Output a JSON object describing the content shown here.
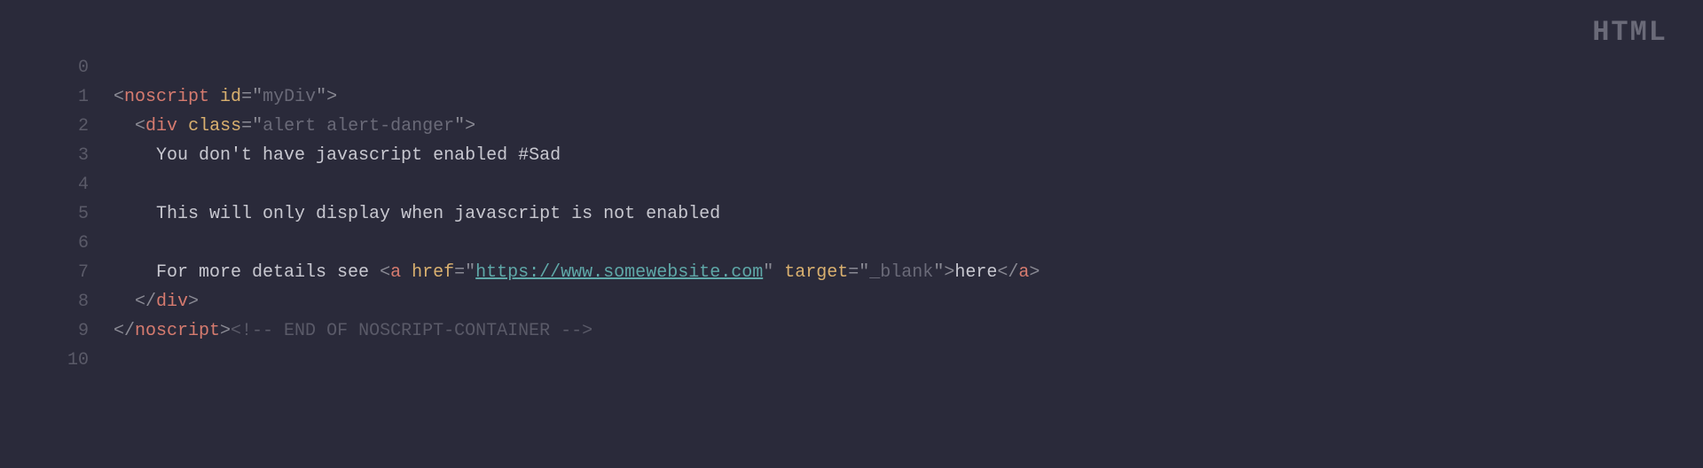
{
  "language_badge": "HTML",
  "gutter": [
    "0",
    "1",
    "2",
    "3",
    "4",
    "5",
    "6",
    "7",
    "8",
    "9",
    "10"
  ],
  "code": {
    "l1": {
      "open": "<",
      "tag": "noscript",
      "sp": " ",
      "attr": "id",
      "eq": "=",
      "q1": "\"",
      "val": "myDiv",
      "q2": "\"",
      "close": ">"
    },
    "l2": {
      "indent": "  ",
      "open": "<",
      "tag": "div",
      "sp": " ",
      "attr": "class",
      "eq": "=",
      "q1": "\"",
      "val": "alert alert-danger",
      "q2": "\"",
      "close": ">"
    },
    "l3": {
      "indent": "    ",
      "text": "You don't have javascript enabled #Sad"
    },
    "l5": {
      "indent": "    ",
      "text": "This will only display when javascript is not enabled"
    },
    "l7": {
      "indent": "    ",
      "text1": "For more details see ",
      "open": "<",
      "tag": "a",
      "sp1": " ",
      "attr1": "href",
      "eq1": "=",
      "q1": "\"",
      "url": "https://www.somewebsite.com",
      "q2": "\"",
      "sp2": " ",
      "attr2": "target",
      "eq2": "=",
      "q3": "\"",
      "val2": "_blank",
      "q4": "\"",
      "close1": ">",
      "linktext": "here",
      "open2": "</",
      "tag2": "a",
      "close2": ">"
    },
    "l8": {
      "indent": "  ",
      "open": "</",
      "tag": "div",
      "close": ">"
    },
    "l9": {
      "open": "</",
      "tag": "noscript",
      "close": ">",
      "comment": "<!-- END OF NOSCRIPT-CONTAINER -->"
    }
  }
}
